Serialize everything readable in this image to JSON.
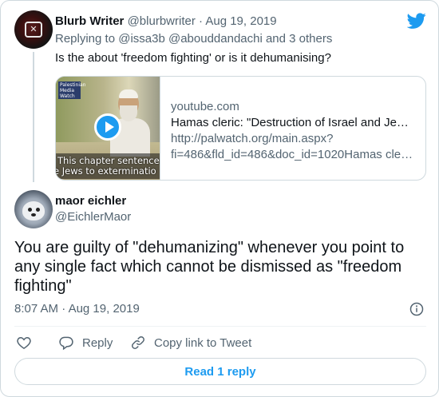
{
  "parent_tweet": {
    "author_name": "Blurb Writer",
    "author_handle": "@blurbwriter",
    "separator": "·",
    "date": "Aug 19, 2019",
    "replying_label": "Replying to",
    "replying_to": "@issa3b @abouddandachi and 3 others",
    "text": "Is the about 'freedom fighting' or is it dehumanising?",
    "link_card": {
      "domain": "youtube.com",
      "title": "Hamas cleric: \"Destruction of Israel and Je…",
      "description_line1": "http://palwatch.org/main.aspx?",
      "description_line2": "fi=486&fld_id=486&doc_id=1020Hamas cle…",
      "thumbnail_caption_line1": "This chapter sentences",
      "thumbnail_caption_line2": "e Jews to exterminatio",
      "thumbnail_tag": "Palestinian Media Watch"
    }
  },
  "main_tweet": {
    "author_name": "maor eichler",
    "author_handle": "@EichlerMaor",
    "text_lines": [
      "You are guilty of \"dehumanizing\" whenever you point to",
      "any single fact which cannot be dismissed as \"freedom",
      "fighting\""
    ],
    "time": "8:07 AM",
    "separator": "·",
    "date": "Aug 19, 2019"
  },
  "actions": {
    "reply_label": "Reply",
    "copy_link_label": "Copy link to Tweet"
  },
  "read_replies_label": "Read 1 reply",
  "colors": {
    "accent": "#1d9bf0",
    "text": "#0f1419",
    "muted": "#536471",
    "border": "#cfd9de"
  },
  "icons": [
    "twitter-bird-icon",
    "play-icon",
    "info-icon",
    "heart-icon",
    "reply-icon",
    "link-icon"
  ]
}
